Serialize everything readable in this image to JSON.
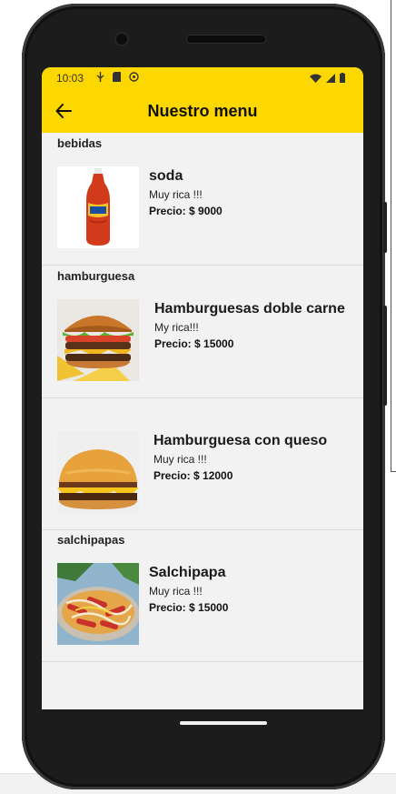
{
  "status_bar": {
    "time": "10:03"
  },
  "app_bar": {
    "title": "Nuestro menu"
  },
  "sections": [
    {
      "title": "bebidas",
      "items": [
        {
          "name": "soda",
          "description": "Muy rica !!!",
          "price": "Precio: $ 9000",
          "icon": "soda-bottle-image"
        }
      ]
    },
    {
      "title": "hamburguesa",
      "items": [
        {
          "name": "Hamburguesas doble carne",
          "description": "My rica!!!",
          "price": "Precio: $ 15000",
          "icon": "double-burger-image"
        },
        {
          "name": "Hamburguesa con queso",
          "description": "Muy rica !!!",
          "price": "Precio: $ 12000",
          "icon": "cheeseburger-image"
        }
      ]
    },
    {
      "title": "salchipapas",
      "items": [
        {
          "name": "Salchipapa",
          "description": "Muy rica !!!",
          "price": "Precio: $ 15000",
          "icon": "salchipapa-image"
        }
      ]
    }
  ],
  "colors": {
    "accent": "#fcd800",
    "background": "#f2f2f2",
    "phone_body": "#1c1c1c"
  }
}
